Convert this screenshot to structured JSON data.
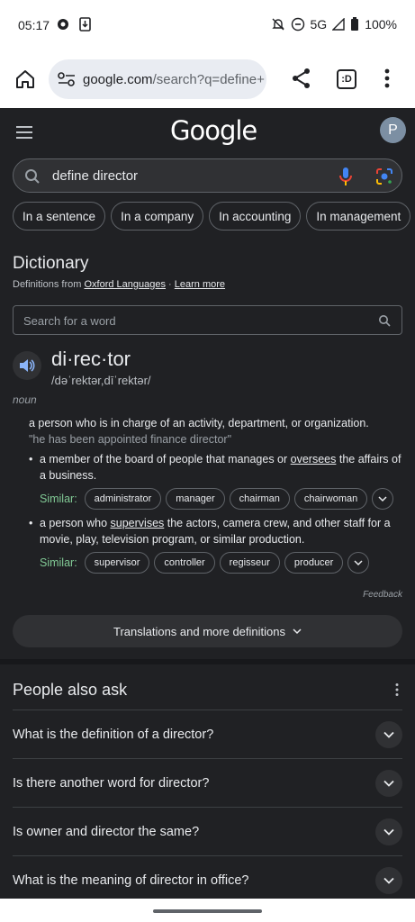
{
  "status_bar": {
    "time": "05:17",
    "network": "5G",
    "battery": "100%"
  },
  "toolbar": {
    "url_domain": "google.com",
    "url_rest": "/search?q=define+",
    "tab_count": ":D"
  },
  "google": {
    "logo": "Google",
    "avatar_initial": "P",
    "search_query": "define director",
    "chips": [
      "In a sentence",
      "In a company",
      "In accounting",
      "In management",
      "I"
    ]
  },
  "dictionary": {
    "title": "Dictionary",
    "source_prefix": "Definitions from ",
    "source_name": "Oxford Languages",
    "source_sep": " · ",
    "learn_more": "Learn more",
    "search_placeholder": "Search for a word",
    "headword": "di·rec·tor",
    "phonetic": "/dəˈrektər,dīˈrektər/",
    "part_of_speech": "noun",
    "definition": "a person who is in charge of an activity, department, or organization.",
    "example": "\"he has been appointed finance director\"",
    "sub1_a": "a member of the board of people that manages or ",
    "sub1_link": "oversees",
    "sub1_b": " the affairs of a business.",
    "sub2_a": "a person who ",
    "sub2_link": "supervises",
    "sub2_b": " the actors, camera crew, and other staff for a movie, play, television program, or similar production.",
    "similar_label": "Similar:",
    "similar1": [
      "administrator",
      "manager",
      "chairman",
      "chairwoman"
    ],
    "similar2": [
      "supervisor",
      "controller",
      "regisseur",
      "producer"
    ],
    "feedback": "Feedback",
    "translations": "Translations and more definitions"
  },
  "people_also_ask": {
    "title": "People also ask",
    "questions": [
      "What is the definition of a director?",
      "Is there another word for director?",
      "Is owner and director the same?",
      "What is the meaning of director in office?"
    ]
  }
}
